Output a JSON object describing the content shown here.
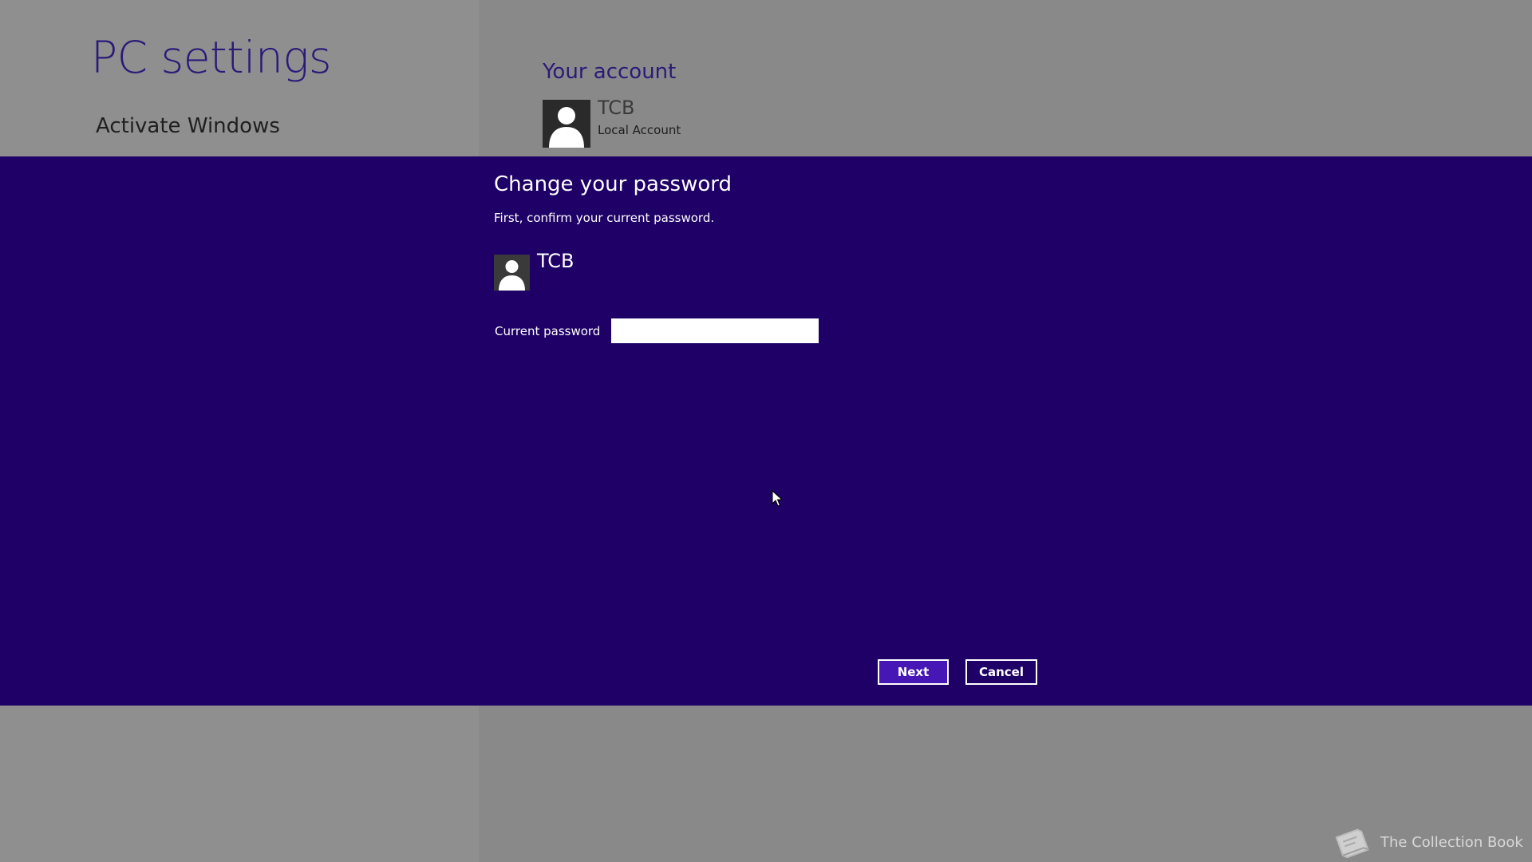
{
  "settings": {
    "title": "PC settings",
    "activate_link": "Activate Windows",
    "account_heading": "Your account",
    "user_name": "TCB",
    "account_type": "Local Account"
  },
  "dialog": {
    "title": "Change your password",
    "subtitle": "First, confirm your current password.",
    "user_name": "TCB",
    "password_label": "Current password",
    "password_value": "",
    "next_label": "Next",
    "cancel_label": "Cancel"
  },
  "watermark": {
    "text": "The Collection Book"
  },
  "colors": {
    "accent": "#1e0066",
    "button_primary": "#4617b4",
    "title_text": "#2b1a78",
    "background": "#8c8c8c"
  },
  "icons": {
    "avatar": "user-silhouette-icon",
    "cursor": "mouse-pointer-icon",
    "watermark": "book-icon"
  }
}
